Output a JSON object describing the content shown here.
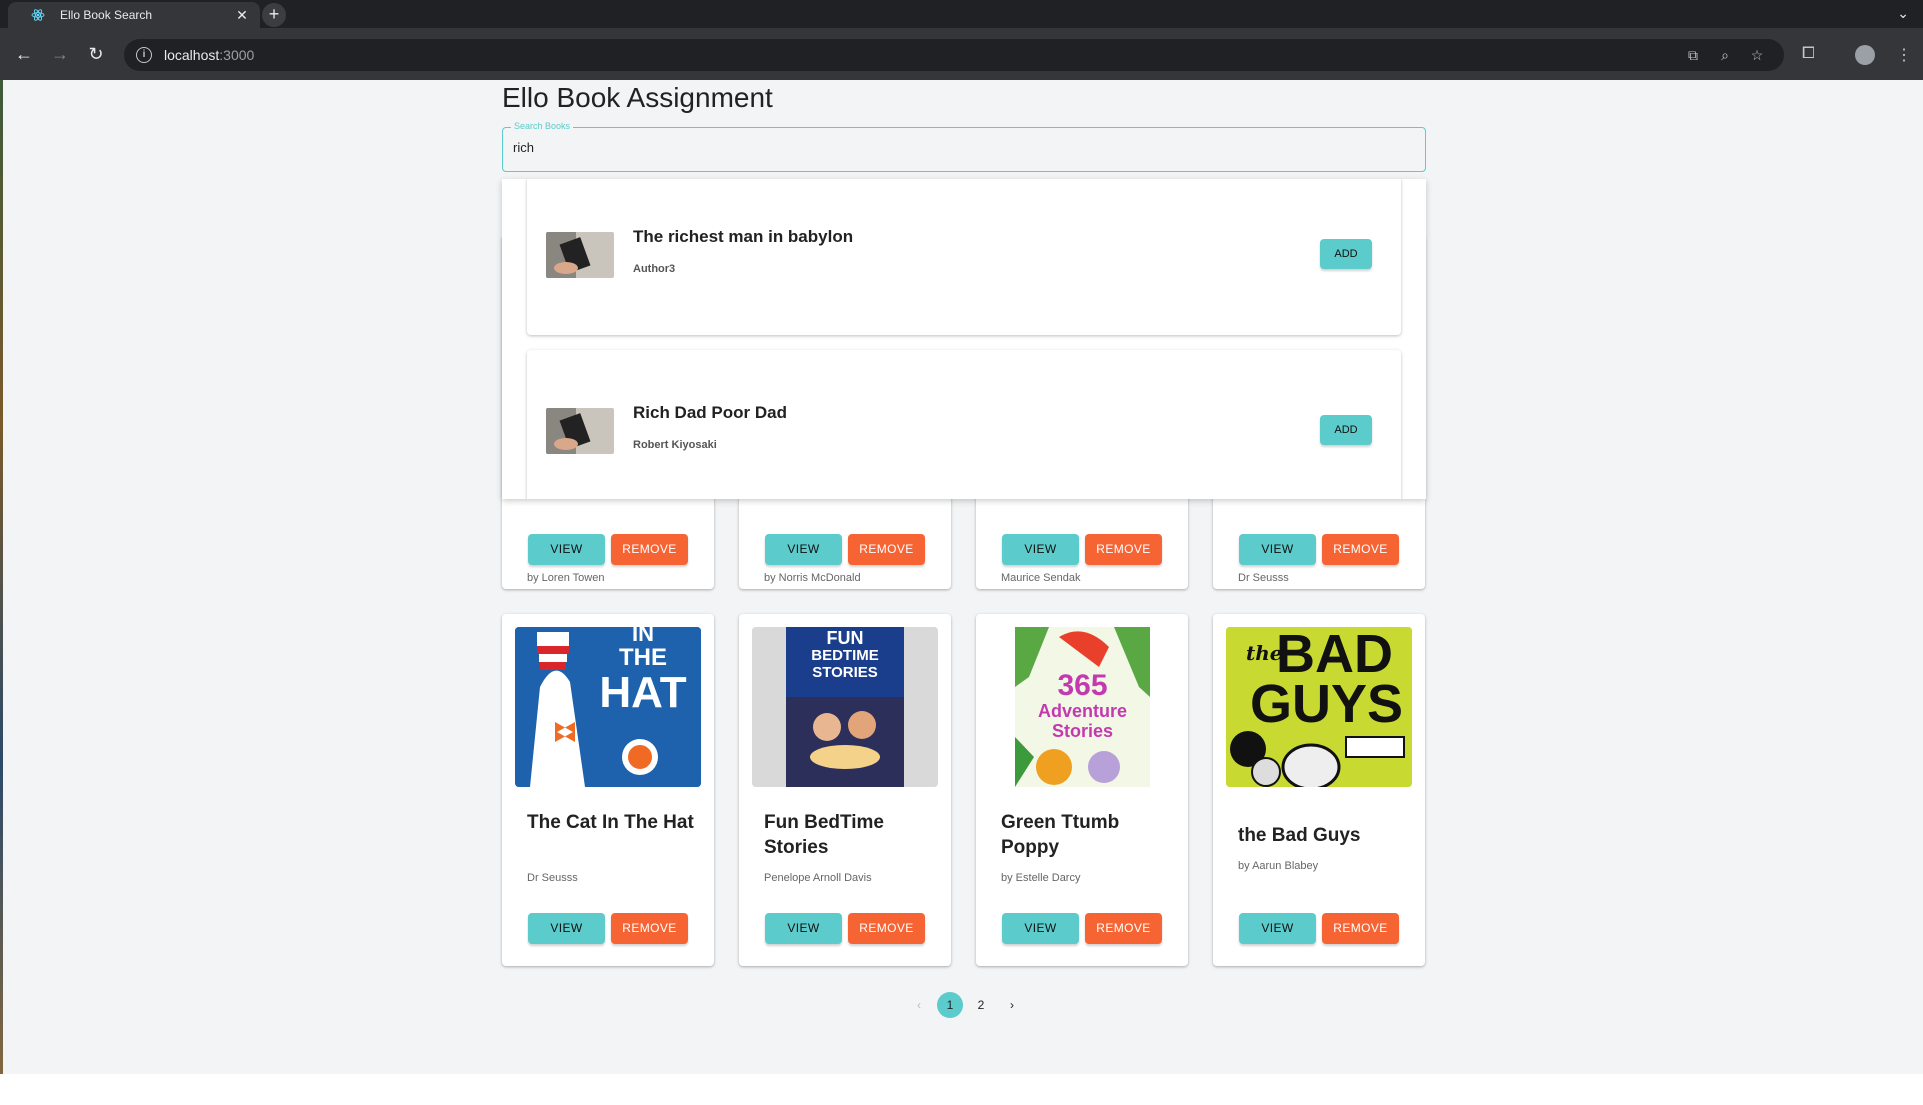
{
  "browser": {
    "tab_title": "Ello Book Search",
    "url_host": "localhost",
    "url_port": ":3000",
    "new_tab_symbol": "+",
    "close_symbol": "✕"
  },
  "app": {
    "title": "Ello Book Assignment"
  },
  "search": {
    "label": "Search Books",
    "value": "rich"
  },
  "results": [
    {
      "title": "The richest man in babylon",
      "author": "Author3",
      "button": "ADD"
    },
    {
      "title": "Rich Dad Poor Dad",
      "author": "Robert Kiyosaki",
      "button": "ADD"
    }
  ],
  "books_row1": [
    {
      "author": "by Loren Towen"
    },
    {
      "author": "by Norris McDonald"
    },
    {
      "author": "Maurice Sendak"
    },
    {
      "author": "Dr Seusss"
    }
  ],
  "books_row2": [
    {
      "title": "The Cat In The Hat",
      "author": "Dr Seusss",
      "cover_text_1": "IN",
      "cover_text_2": "THE",
      "cover_text_3": "HAT"
    },
    {
      "title": "Fun BedTime Stories",
      "author": "Penelope Arnoll Davis",
      "cover_text_1": "FUN",
      "cover_text_2": "BEDTIME",
      "cover_text_3": "STORIES"
    },
    {
      "title": "Green Ttumb Poppy",
      "author": "by Estelle Darcy",
      "cover_text_1": "365",
      "cover_text_2": "Adventure",
      "cover_text_3": "Stories"
    },
    {
      "title": "the Bad Guys",
      "author": "by Aarun Blabey",
      "cover_text_1": "the",
      "cover_text_2": "BAD",
      "cover_text_3": "GUYS"
    }
  ],
  "buttons": {
    "view": "VIEW",
    "remove": "REMOVE"
  },
  "pagination": {
    "prev": "‹",
    "pages": [
      "1",
      "2"
    ],
    "next": "›",
    "current": "1"
  },
  "colors": {
    "accent": "#5ccbcb",
    "remove": "#f76434"
  }
}
